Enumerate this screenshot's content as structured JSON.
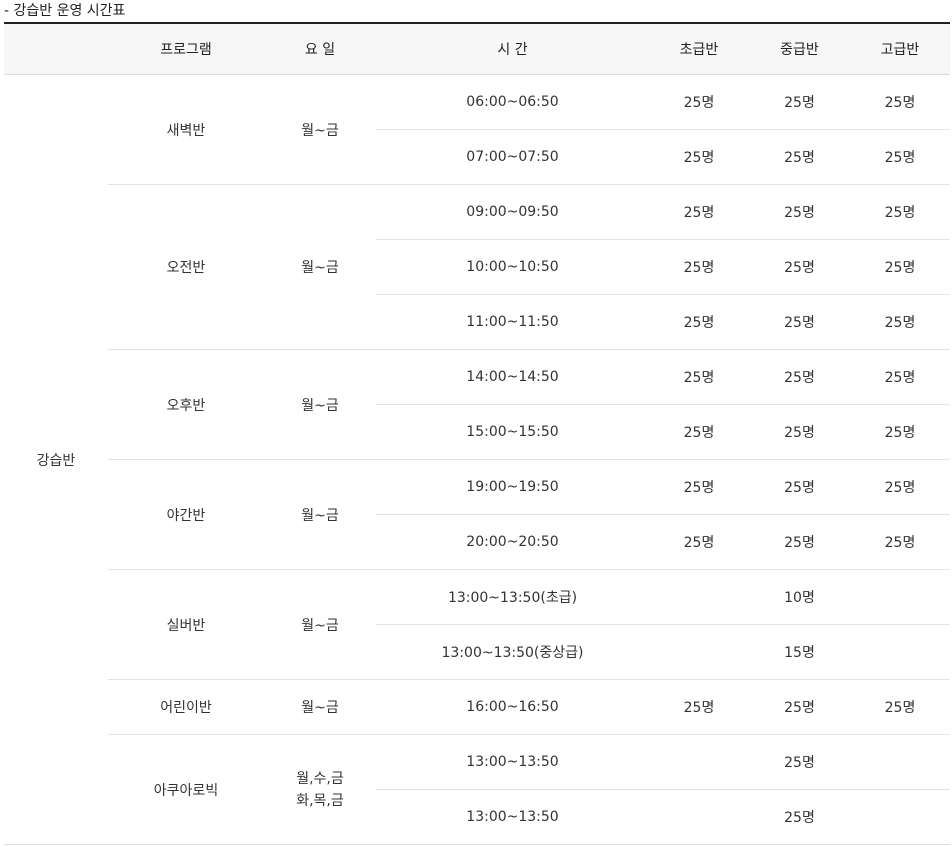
{
  "caption": "- 강습반 운영 시간표",
  "headers": [
    "프로그램",
    "요 일",
    "시 간",
    "초급반",
    "중급반",
    "고급반"
  ],
  "group": "강습반",
  "programs": [
    {
      "name": "새벽반",
      "days": "월~금",
      "slots": [
        {
          "time": "06:00~06:50",
          "beginner": "25명",
          "intermediate": "25명",
          "advanced": "25명"
        },
        {
          "time": "07:00~07:50",
          "beginner": "25명",
          "intermediate": "25명",
          "advanced": "25명"
        }
      ]
    },
    {
      "name": "오전반",
      "days": "월~금",
      "slots": [
        {
          "time": "09:00~09:50",
          "beginner": "25명",
          "intermediate": "25명",
          "advanced": "25명"
        },
        {
          "time": "10:00~10:50",
          "beginner": "25명",
          "intermediate": "25명",
          "advanced": "25명"
        },
        {
          "time": "11:00~11:50",
          "beginner": "25명",
          "intermediate": "25명",
          "advanced": "25명"
        }
      ]
    },
    {
      "name": "오후반",
      "days": "월~금",
      "slots": [
        {
          "time": "14:00~14:50",
          "beginner": "25명",
          "intermediate": "25명",
          "advanced": "25명"
        },
        {
          "time": "15:00~15:50",
          "beginner": "25명",
          "intermediate": "25명",
          "advanced": "25명"
        }
      ]
    },
    {
      "name": "야간반",
      "days": "월~금",
      "slots": [
        {
          "time": "19:00~19:50",
          "beginner": "25명",
          "intermediate": "25명",
          "advanced": "25명"
        },
        {
          "time": "20:00~20:50",
          "beginner": "25명",
          "intermediate": "25명",
          "advanced": "25명"
        }
      ]
    },
    {
      "name": "실버반",
      "days": "월~금",
      "slots": [
        {
          "time": "13:00~13:50(초급)",
          "capacity": "10명"
        },
        {
          "time": "13:00~13:50(중상급)",
          "capacity": "15명"
        }
      ]
    },
    {
      "name": "어린이반",
      "days": "월~금",
      "slots": [
        {
          "time": "16:00~16:50",
          "beginner": "25명",
          "intermediate": "25명",
          "advanced": "25명"
        }
      ]
    },
    {
      "name": "아쿠아로빅",
      "days_lines": [
        "월,수,금",
        "화,목,금"
      ],
      "slots": [
        {
          "time": "13:00~13:50",
          "capacity": "25명"
        },
        {
          "time": "13:00~13:50",
          "capacity": "25명"
        }
      ]
    }
  ]
}
